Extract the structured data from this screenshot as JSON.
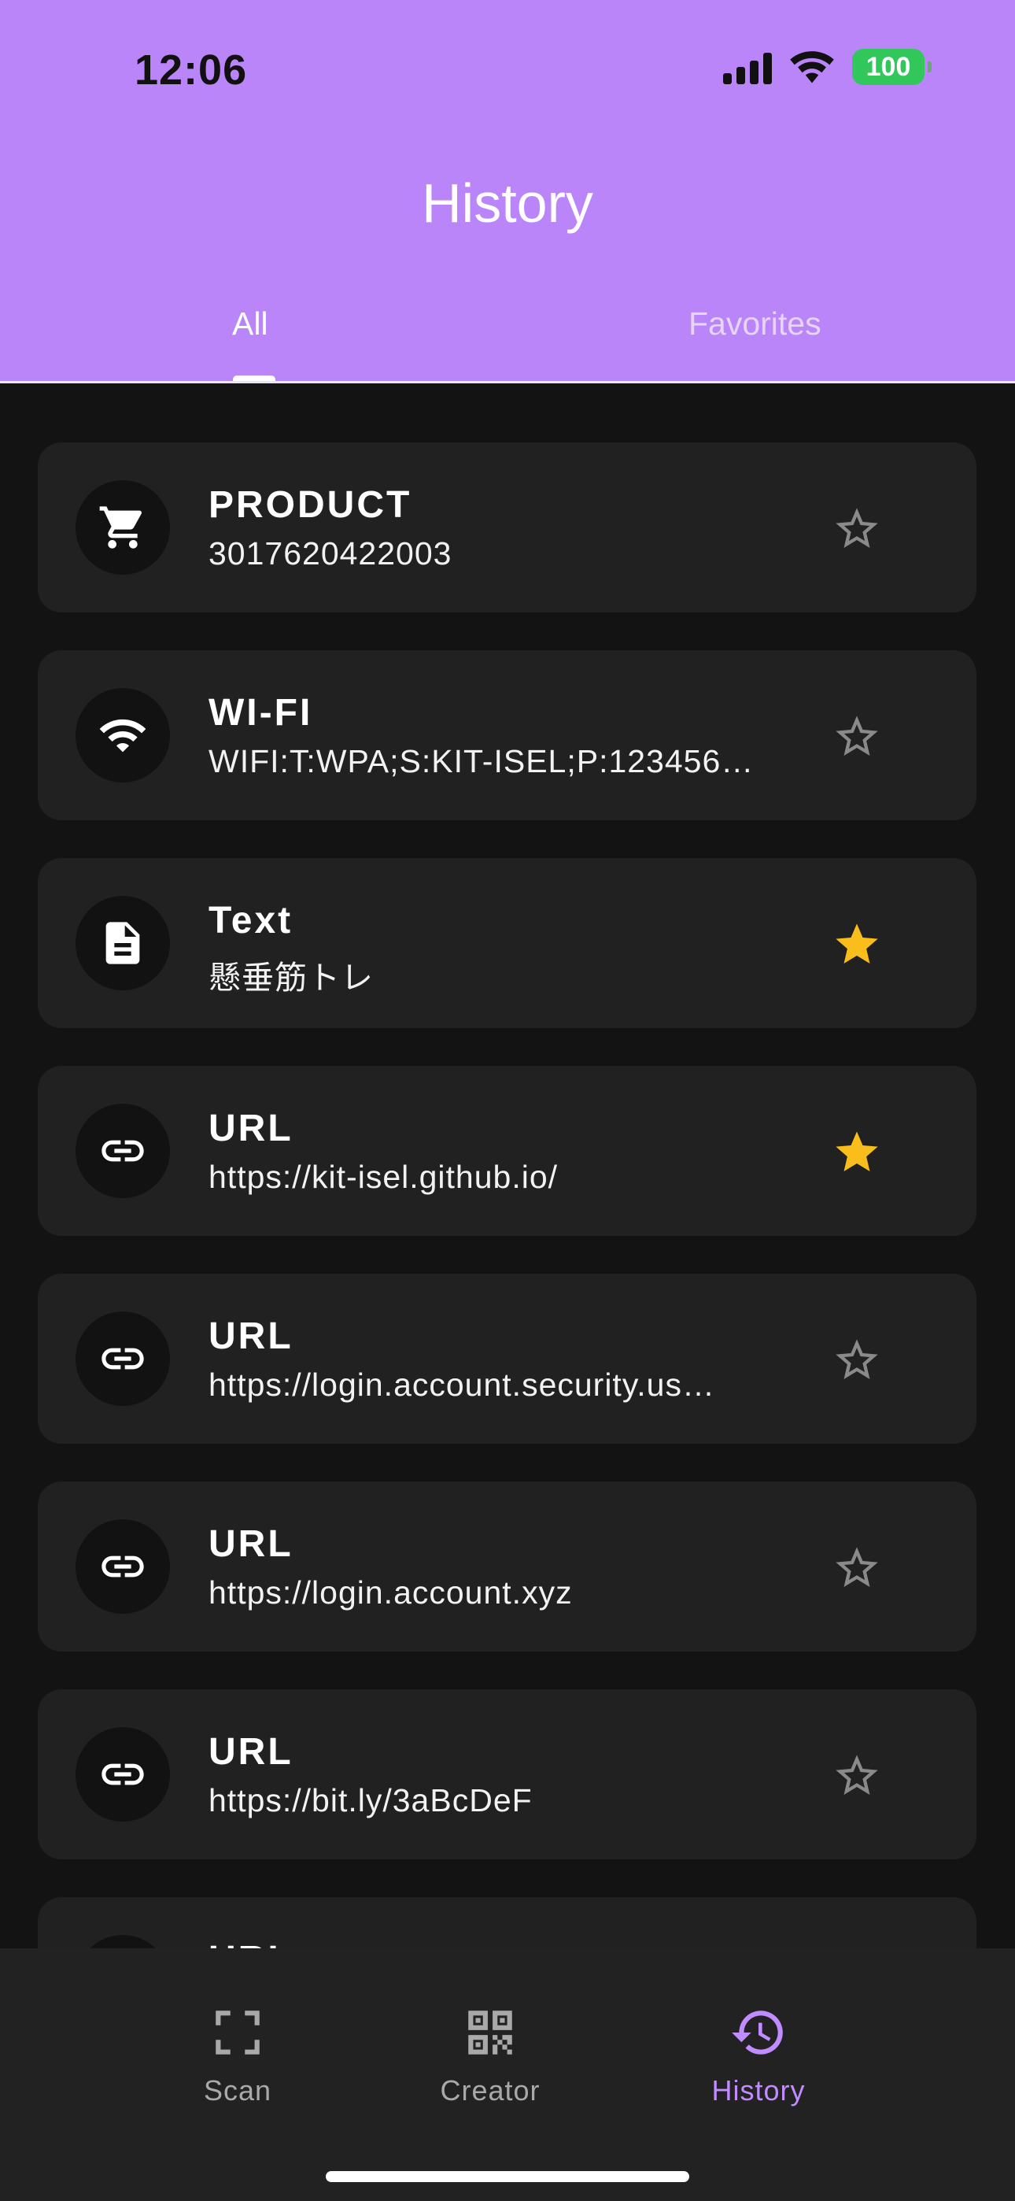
{
  "status_bar": {
    "time": "12:06",
    "battery": "100"
  },
  "header": {
    "title": "History",
    "tabs": [
      {
        "label": "All",
        "selected": true
      },
      {
        "label": "Favorites",
        "selected": false
      }
    ]
  },
  "history_items": [
    {
      "type": "PRODUCT",
      "value": "3017620422003",
      "icon": "cart-icon",
      "favorite": false
    },
    {
      "type": "WI-FI",
      "value": "WIFI:T:WPA;S:KIT-ISEL;P:123456…",
      "icon": "wifi-icon",
      "favorite": false
    },
    {
      "type": "Text",
      "value": "懸垂筋トレ",
      "icon": "document-icon",
      "favorite": true
    },
    {
      "type": "URL",
      "value": "https://kit-isel.github.io/",
      "icon": "link-icon",
      "favorite": true
    },
    {
      "type": "URL",
      "value": "https://login.account.security.us…",
      "icon": "link-icon",
      "favorite": false
    },
    {
      "type": "URL",
      "value": "https://login.account.xyz",
      "icon": "link-icon",
      "favorite": false
    },
    {
      "type": "URL",
      "value": "https://bit.ly/3aBcDeF",
      "icon": "link-icon",
      "favorite": false
    },
    {
      "type": "URL",
      "value": "",
      "icon": "link-icon",
      "favorite": false
    }
  ],
  "bottom_nav": [
    {
      "label": "Scan",
      "icon": "scan-icon",
      "active": false
    },
    {
      "label": "Creator",
      "icon": "qr-code-icon",
      "active": false
    },
    {
      "label": "History",
      "icon": "history-icon",
      "active": true
    }
  ],
  "colors": {
    "header": "#b985f9",
    "accent": "#c08cff",
    "favorite_star": "#f9bd1c",
    "card": "#212121",
    "background": "#131313"
  }
}
